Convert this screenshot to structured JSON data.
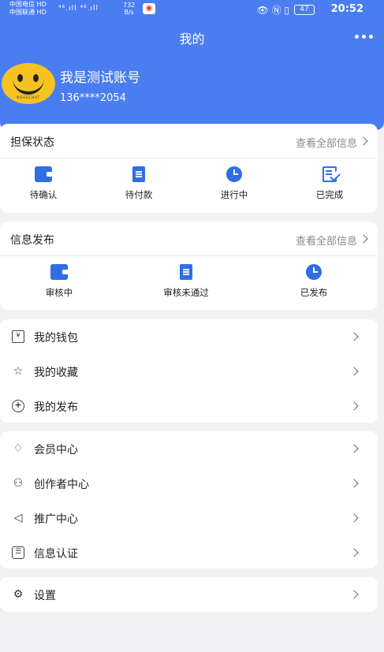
{
  "statusbar": {
    "carrier1": "中国电信",
    "carrier2": "中国联通",
    "hd": "HD",
    "signal": "⁴⁶.ıll ⁴⁶.ıll",
    "speed_value": "732",
    "speed_unit": "B/s",
    "battery": "47",
    "time": "20:52"
  },
  "header": {
    "title": "我的",
    "more_icon": "more-dots-icon"
  },
  "profile": {
    "avatar_icon": "smiley-face-avatar",
    "avatar_text": "WEEECHAT",
    "name": "我是测试账号",
    "phone": "136****2054"
  },
  "guarantee": {
    "title": "担保状态",
    "view_all": "查看全部信息",
    "items": [
      {
        "label": "待确认",
        "icon": "wallet-icon"
      },
      {
        "label": "待付款",
        "icon": "document-icon"
      },
      {
        "label": "进行中",
        "icon": "clock-icon"
      },
      {
        "label": "已完成",
        "icon": "check-document-icon"
      }
    ]
  },
  "publish": {
    "title": "信息发布",
    "view_all": "查看全部信息",
    "items": [
      {
        "label": "审核中",
        "icon": "wallet-icon"
      },
      {
        "label": "审核未通过",
        "icon": "document-icon"
      },
      {
        "label": "已发布",
        "icon": "clock-icon"
      }
    ]
  },
  "menu1": [
    {
      "label": "我的钱包",
      "icon": "wallet-outline-icon"
    },
    {
      "label": "我的收藏",
      "icon": "star-icon"
    },
    {
      "label": "我的发布",
      "icon": "plus-circle-icon"
    }
  ],
  "menu2": [
    {
      "label": "会员中心",
      "icon": "diamond-icon"
    },
    {
      "label": "创作者中心",
      "icon": "user-plus-icon"
    },
    {
      "label": "推广中心",
      "icon": "megaphone-icon"
    },
    {
      "label": "信息认证",
      "icon": "id-card-icon"
    }
  ],
  "menu3": [
    {
      "label": "设置",
      "icon": "gear-icon"
    }
  ],
  "colors": {
    "primary": "#4a7df0",
    "icon_blue": "#2f6ee5",
    "background": "#f2f2f4"
  }
}
